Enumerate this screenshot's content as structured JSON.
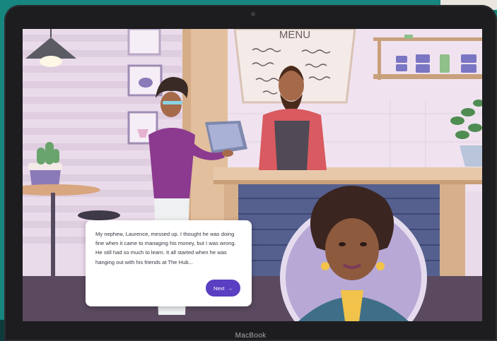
{
  "device": {
    "label": "MacBook"
  },
  "scene": {
    "menu_sign": "MENU"
  },
  "dialog": {
    "text": "My nephew, Laurence, messed up. I thought he was doing fine when it came to managing his money, but I was wrong. He still had so much to learn. It all started when he was hanging out with his friends at The Hub...",
    "next_label": "Next",
    "next_icon": "arrow-right-icon"
  },
  "colors": {
    "accent": "#5a3fc2",
    "wall": "#e9dbe9",
    "counter": "#e4c5a6",
    "background": "#17867f"
  }
}
